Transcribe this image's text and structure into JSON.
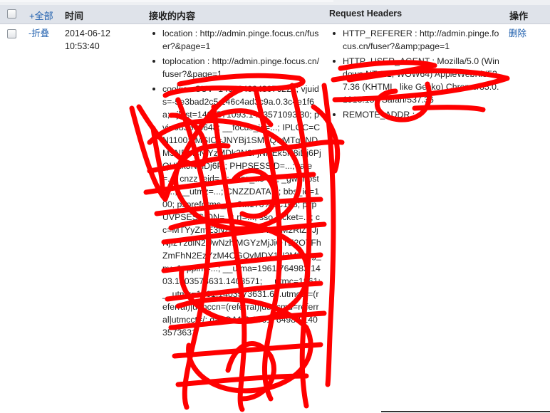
{
  "header": {
    "select_all": "+全部",
    "col_time": "时间",
    "col_content": "接收的内容",
    "col_headers": "Request Headers",
    "col_action": "操作"
  },
  "row": {
    "collapse": "-折叠",
    "date": "2014-06-12",
    "time": "10:53:40",
    "content_items": [
      "location : http://admin.pinge.focus.cn/fuser?&page=1",
      "toplocation : http://admin.pinge.focus.cn/fuser?&page=1",
      "cookie : SUV=1406240943076221; vjuids=-5e3bad2c5.146c4ad3c9a.0.3c4e1f6a; vjlast=1403571093.1403571093.30; pvi=683665648; __focus_id=...; IPLOC=CN1100; IMSIC=JNYBj1SMTQwMTg1NDM3NDM4NjYzMDk2N2FjNHEk5N8iDj6PjQHEk5N8iDj6Pj; PHPSESSID=...; rate=...; cnzz_eid=...; cnzz_a5=...; _gwphost=...; __utmz=...; CNZZDATA...; bbs_id=100; pspreforms_w=6...170%2C163; pvpUVPSESSION=...; rf=...; sso_ticket=...; cc=MTYyZmE3NzFlOTA0OWI0M2RlZTJjNjIzYzdlN2UwNzhjMGYzMjJiOTE2OTFhZmFhN2EzYzM4OGQyMDY1N2M3; gg_pv=1; ppinf=...; __utma=1961.764983.1403.1403573631.1403571; __utmc=1961; __utmz=1961.1403573631.64.utmcsr=(referral)|utmccn=(referral)|utmcmd=referral|utmcct=/; ga=GA1.2.1961764983.1403573631"
    ],
    "header_items": [
      "HTTP_REFERER : http://admin.pinge.focus.cn/fuser?&amp;page=1",
      "HTTP_USER_AGENT : Mozilla/5.0 (Windows NT 6.1; WOW64) AppleWebKit/537.36 (KHTML, like Gecko) Chrome/35.0.1916.153 Safari/537.36",
      "REMOTE_ADDR : "
    ],
    "delete": "删除"
  },
  "colors": {
    "header_bg": "#dfe3ea",
    "link": "#1f5fae",
    "scribble": "#ff0000"
  }
}
